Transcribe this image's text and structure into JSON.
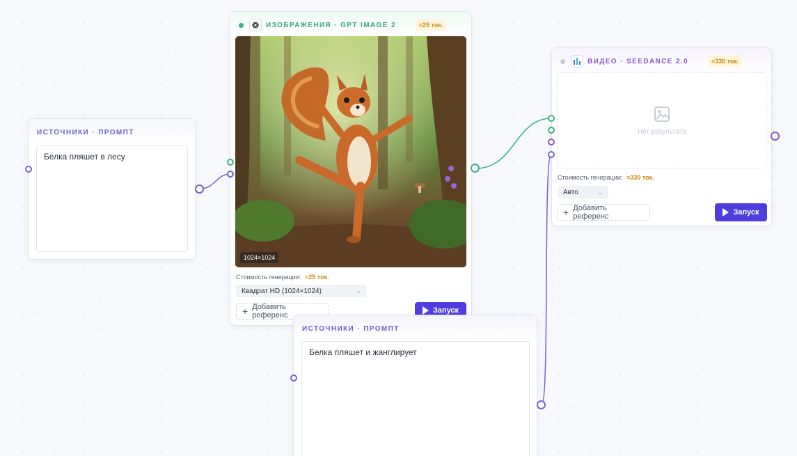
{
  "prompt_node_1": {
    "title": "ИСТОЧНИКИ · ПРОМПТ",
    "text": "Белка пляшет в лесу"
  },
  "image_node": {
    "title": "ИЗОБРАЖЕНИЯ · GPT IMAGE 2",
    "cost_badge": "≈25 ток.",
    "dimensions": "1024×1024",
    "cost_label": "Стоимость генерации:",
    "cost_value": "≈25 ток.",
    "size_select": "Квадрат HD (1024×1024)",
    "add_reference": "Добавить референс",
    "run": "Запуск",
    "status_color": "#36b37e",
    "icon": "openai-logo-icon"
  },
  "video_node": {
    "title": "ВИДЕО · SEEDANCE 2.0",
    "cost_badge": "≈330 ток.",
    "empty_text": "Нет результата",
    "cost_label": "Стоимость генерации:",
    "cost_value": "≈330 ток.",
    "mode_select": "Авто",
    "add_reference": "Добавить референс",
    "run": "Запуск",
    "status_color": "#c9ccd6",
    "icon": "bar-chart-logo-icon"
  },
  "prompt_node_2": {
    "title": "ИСТОЧНИКИ · ПРОМПТ",
    "text": "Белка пляшет и жанглирует"
  },
  "colors": {
    "accent": "#4f3de0",
    "prompt_port": "#6d67c8",
    "image_wire": "#36b37e",
    "video_port": "#8a56c9",
    "badge_text": "#c78a10"
  }
}
